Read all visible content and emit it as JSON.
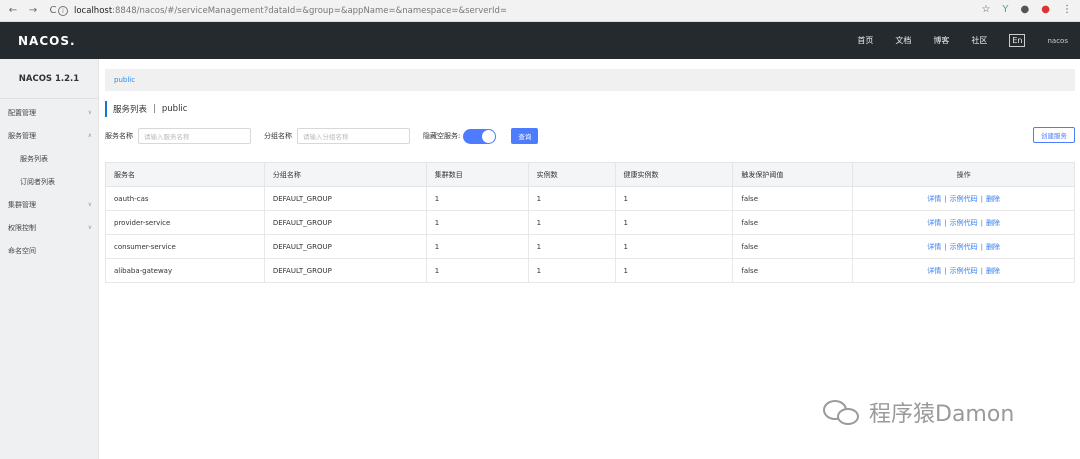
{
  "browser": {
    "back": "←",
    "forward": "→",
    "reload": "C",
    "url_host": "localhost",
    "url_rest": ":8848/nacos/#/serviceManagement?dataId=&group=&appName=&namespace=&serverId="
  },
  "header": {
    "logo": "NACOS.",
    "nav": [
      "首页",
      "文档",
      "博客",
      "社区"
    ],
    "lang": "En",
    "user": "nacos"
  },
  "sidebar": {
    "version": "NACOS 1.2.1",
    "items": [
      {
        "label": "配置管理"
      },
      {
        "label": "服务管理"
      },
      {
        "label": "服务列表"
      },
      {
        "label": "订阅者列表"
      },
      {
        "label": "集群管理"
      },
      {
        "label": "权限控制"
      },
      {
        "label": "命名空间"
      }
    ]
  },
  "main": {
    "breadcrumb": "public",
    "title": "服务列表",
    "title_sep": "|",
    "namespace": "public",
    "filters": {
      "service_name_label": "服务名称",
      "service_name_placeholder": "请输入服务名称",
      "group_name_label": "分组名称",
      "group_name_placeholder": "请输入分组名称",
      "hide_empty_label": "隐藏空服务:",
      "hide_empty_on": true,
      "query_button": "查询"
    },
    "create_button": "创建服务",
    "table": {
      "headers": [
        "服务名",
        "分组名称",
        "集群数目",
        "实例数",
        "健康实例数",
        "触发保护阈值",
        "操作"
      ],
      "rows": [
        {
          "name": "oauth-cas",
          "group": "DEFAULT_GROUP",
          "clusters": "1",
          "instances": "1",
          "healthy": "1",
          "protect": "false"
        },
        {
          "name": "provider-service",
          "group": "DEFAULT_GROUP",
          "clusters": "1",
          "instances": "1",
          "healthy": "1",
          "protect": "false"
        },
        {
          "name": "consumer-service",
          "group": "DEFAULT_GROUP",
          "clusters": "1",
          "instances": "1",
          "healthy": "1",
          "protect": "false"
        },
        {
          "name": "alibaba-gateway",
          "group": "DEFAULT_GROUP",
          "clusters": "1",
          "instances": "1",
          "healthy": "1",
          "protect": "false"
        }
      ],
      "ops": {
        "detail": "详情",
        "sample": "示例代码",
        "delete": "删除",
        "sep": "|"
      }
    }
  },
  "watermark": "程序猿Damon",
  "colors": {
    "primary": "#4d7cfe",
    "topnav": "#252a2f",
    "link": "#2d7cf0"
  }
}
